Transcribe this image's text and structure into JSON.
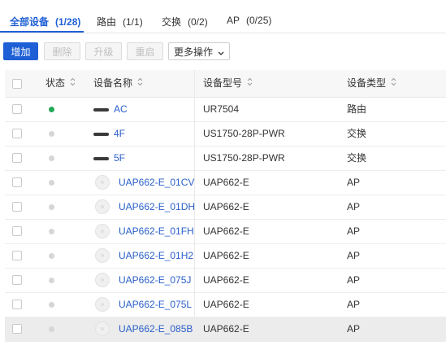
{
  "tabs": [
    {
      "label": "全部设备",
      "count": "(1/28)",
      "active": true
    },
    {
      "label": "路由",
      "count": "(1/1)",
      "active": false
    },
    {
      "label": "交换",
      "count": "(0/2)",
      "active": false
    },
    {
      "label": "AP",
      "count": "(0/25)",
      "active": false
    }
  ],
  "toolbar": {
    "add_label": "增加",
    "delete_label": "删除",
    "upgrade_label": "升级",
    "restart_label": "重启",
    "more_label": "更多操作"
  },
  "table": {
    "headers": {
      "status": "状态",
      "name": "设备名称",
      "model": "设备型号",
      "type": "设备类型"
    },
    "rows": [
      {
        "status": "online",
        "icon": "router-icon",
        "name": "AC",
        "model": "UR7504",
        "type": "路由"
      },
      {
        "status": "offline",
        "icon": "switch-icon",
        "name": "4F",
        "model": "US1750-28P-PWR",
        "type": "交换"
      },
      {
        "status": "offline",
        "icon": "switch-icon",
        "name": "5F",
        "model": "US1750-28P-PWR",
        "type": "交换"
      },
      {
        "status": "offline",
        "icon": "ap-icon",
        "name": "UAP662-E_01CV",
        "model": "UAP662-E",
        "type": "AP"
      },
      {
        "status": "offline",
        "icon": "ap-icon",
        "name": "UAP662-E_01DH",
        "model": "UAP662-E",
        "type": "AP"
      },
      {
        "status": "offline",
        "icon": "ap-icon",
        "name": "UAP662-E_01FH",
        "model": "UAP662-E",
        "type": "AP"
      },
      {
        "status": "offline",
        "icon": "ap-icon",
        "name": "UAP662-E_01H2",
        "model": "UAP662-E",
        "type": "AP"
      },
      {
        "status": "offline",
        "icon": "ap-icon",
        "name": "UAP662-E_075J",
        "model": "UAP662-E",
        "type": "AP"
      },
      {
        "status": "offline",
        "icon": "ap-icon",
        "name": "UAP662-E_075L",
        "model": "UAP662-E",
        "type": "AP"
      },
      {
        "status": "offline",
        "icon": "ap-icon",
        "name": "UAP662-E_085B",
        "model": "UAP662-E",
        "type": "AP",
        "highlighted": true
      }
    ]
  },
  "colors": {
    "accent": "#1f5fd6",
    "online": "#22a858",
    "offline": "#d6d6d6",
    "link": "#2a5fc9"
  }
}
